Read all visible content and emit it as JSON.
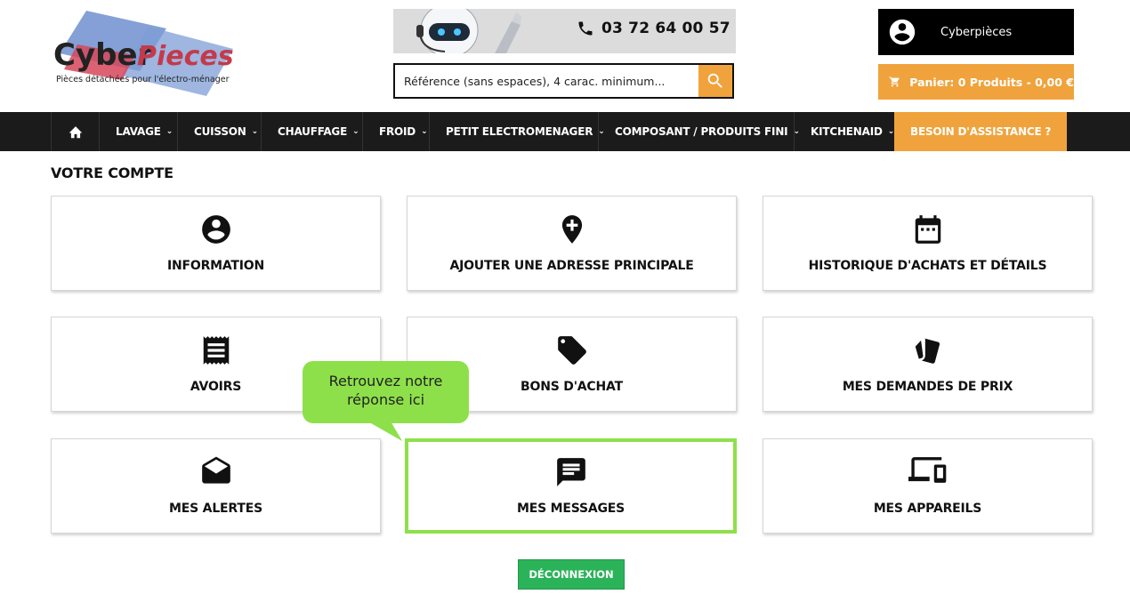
{
  "brand": {
    "name_part1": "Cyber",
    "name_part2": "Pieces",
    "tagline": "Pièces détachées pour l'électro-ménager"
  },
  "header": {
    "phone": "03 72 64 00 57",
    "search_placeholder": "Référence (sans espaces), 4 carac. minimum...",
    "account_label": "Cyberpièces",
    "cart_label": "Panier: 0 Produits - 0,00 €"
  },
  "nav": {
    "items": [
      {
        "label": "LAVAGE"
      },
      {
        "label": "CUISSON"
      },
      {
        "label": "CHAUFFAGE"
      },
      {
        "label": "FROID"
      },
      {
        "label": "PETIT ELECTROMENAGER"
      },
      {
        "label": "COMPOSANT / PRODUITS FINI"
      },
      {
        "label": "KITCHENAID"
      }
    ],
    "assist_label": "BESOIN D'ASSISTANCE ?"
  },
  "page": {
    "title": "VOTRE COMPTE"
  },
  "cards": [
    {
      "label": "INFORMATION",
      "icon": "account-circle-icon"
    },
    {
      "label": "AJOUTER UNE ADRESSE PRINCIPALE",
      "icon": "add-location-icon"
    },
    {
      "label": "HISTORIQUE D'ACHATS ET DÉTAILS",
      "icon": "calendar-icon"
    },
    {
      "label": "AVOIRS",
      "icon": "receipt-icon"
    },
    {
      "label": "BONS D'ACHAT",
      "icon": "tag-icon"
    },
    {
      "label": "MES DEMANDES DE PRIX",
      "icon": "price-cards-icon"
    },
    {
      "label": "MES ALERTES",
      "icon": "open-envelope-icon"
    },
    {
      "label": "MES MESSAGES",
      "icon": "message-icon"
    },
    {
      "label": "MES APPAREILS",
      "icon": "devices-icon"
    }
  ],
  "tooltip": {
    "text_line1": "Retrouvez notre",
    "text_line2": "réponse ici"
  },
  "logout_label": "DÉCONNEXION",
  "colors": {
    "accent_orange": "#f0a33c",
    "highlight_green": "#8ee04a",
    "logout_green": "#2bb35a",
    "nav_bg": "#1b1b1b"
  }
}
